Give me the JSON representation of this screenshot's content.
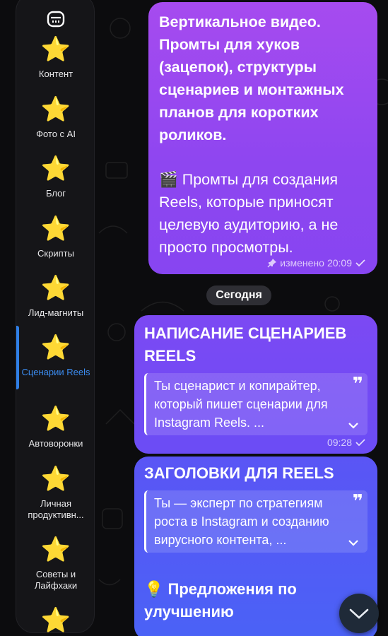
{
  "sidebar": {
    "top_icon": "folders-icon",
    "folders": [
      {
        "icon": "star-icon",
        "label": "Контент"
      },
      {
        "icon": "star-icon",
        "label": "Фото с AI"
      },
      {
        "icon": "star-icon",
        "label": "Блог"
      },
      {
        "icon": "star-icon",
        "label": "Скрипты"
      },
      {
        "icon": "star-icon",
        "label": "Лид-магниты"
      },
      {
        "icon": "star-icon",
        "label": "Сценарии Reels",
        "active": true
      },
      {
        "icon": "star-icon",
        "label": "Автоворонки"
      },
      {
        "icon": "star-icon",
        "label": "Личная продуктивн..."
      },
      {
        "icon": "star-icon",
        "label": "Советы и Лайфхаки"
      },
      {
        "icon": "star-icon",
        "label": ""
      }
    ]
  },
  "messages": {
    "m1": {
      "bold_text": "Вертикальное видео. Промты для хуков (зацепок), структуры сценариев и монтажных планов для коротких роликов.",
      "text": "🎬 Промты для создания Reels, которые приносят целевую аудиторию, а не просто просмотры.",
      "edited": "изменено",
      "time": "20:09"
    },
    "date_separator": "Сегодня",
    "m2": {
      "title": "НАПИСАНИЕ СЦЕНАРИЕВ REELS",
      "quote": "Ты сценарист и копирайтер, который пишет сценарии для Instagram Reels. ...",
      "quote_mark": "❞",
      "time": "09:28"
    },
    "m3": {
      "title": "ЗАГОЛОВКИ ДЛЯ REELS",
      "quote": "Ты — эксперт по стратегиям роста в Instagram и созданию вирусного контента, ...",
      "quote_mark": "❞",
      "suggest": "💡 Предложения по улучшению"
    }
  },
  "colors": {
    "accent": "#2f7fe6",
    "bubble_purple": "#a64bef",
    "bubble_violet": "#6b4cf5",
    "bubble_blue": "#4a62f6"
  }
}
